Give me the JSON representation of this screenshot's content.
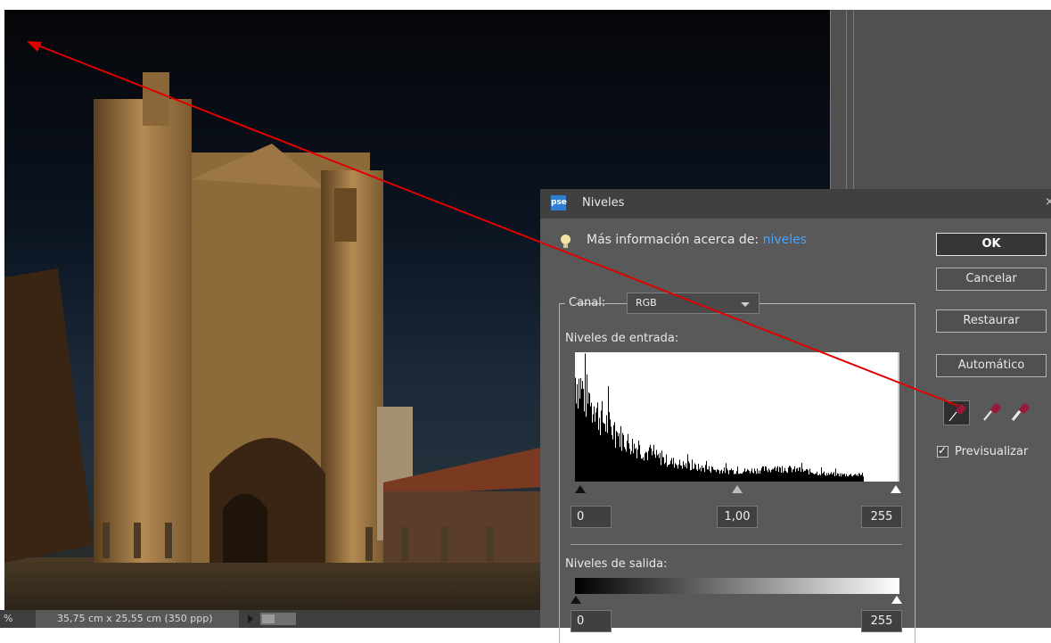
{
  "dialog": {
    "title": "Niveles",
    "logo_text": "pse",
    "close_glyph": "×",
    "info_prefix": "Más información acerca de:",
    "info_link": "niveles",
    "channel_label": "Canal:",
    "channel_value": "RGB",
    "input_levels_label": "Niveles de entrada:",
    "input_black": "0",
    "input_gamma": "1,00",
    "input_white": "255",
    "output_levels_label": "Niveles de salida:",
    "output_black": "0",
    "output_white": "255",
    "buttons": {
      "ok": "OK",
      "cancel": "Cancelar",
      "reset": "Restaurar",
      "auto": "Automático"
    },
    "preview_label": "Previsualizar",
    "preview_checked": true,
    "icons": [
      "lightbulb-icon",
      "black-eyedropper-icon",
      "gray-eyedropper-icon",
      "white-eyedropper-icon"
    ]
  },
  "statusbar": {
    "zoom": "%",
    "document_size": "35,75 cm x 25,55 cm (350 ppp)"
  },
  "colors": {
    "accent_link": "#4aa3ff",
    "annotation_arrow": "#e00000",
    "dialog_bg": "#595959"
  }
}
